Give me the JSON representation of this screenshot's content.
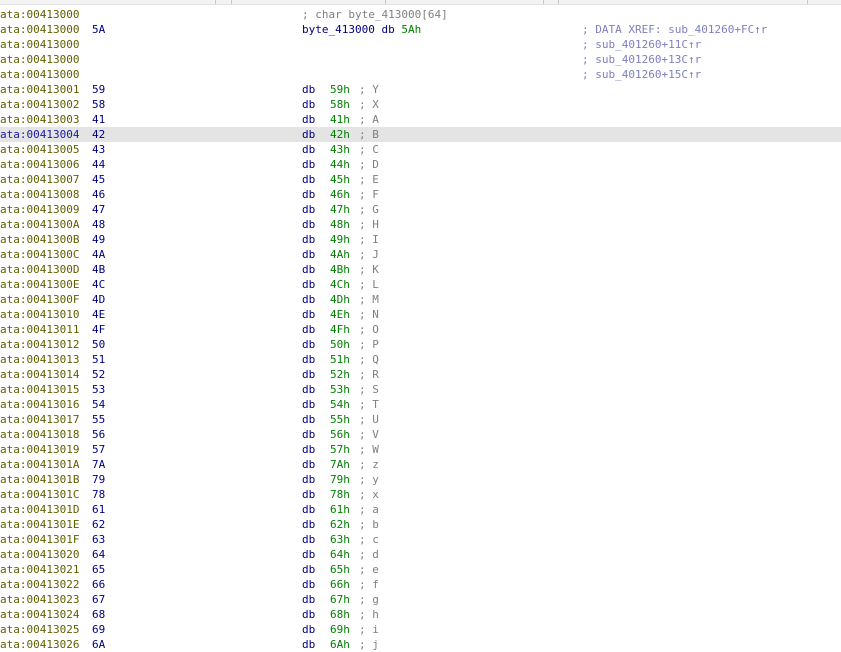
{
  "header": {
    "comment": "; char byte_413000[64]",
    "address": "ata:00413000"
  },
  "definition": {
    "address": "ata:00413000",
    "byte": "5A",
    "name": "byte_413000",
    "directive": "db",
    "value": "5Ah",
    "xref": "; DATA XREF: sub_401260+FC↑r"
  },
  "xref_lines": [
    {
      "address": "ata:00413000",
      "xref": "; sub_401260+11C↑r"
    },
    {
      "address": "ata:00413000",
      "xref": "; sub_401260+13C↑r"
    },
    {
      "address": "ata:00413000",
      "xref": "; sub_401260+15C↑r"
    }
  ],
  "rows": [
    {
      "address": "ata:00413001",
      "byte": "59",
      "op": "db",
      "value": "59h",
      "comment": "; Y"
    },
    {
      "address": "ata:00413002",
      "byte": "58",
      "op": "db",
      "value": "58h",
      "comment": "; X"
    },
    {
      "address": "ata:00413003",
      "byte": "41",
      "op": "db",
      "value": "41h",
      "comment": "; A"
    },
    {
      "address": "ata:00413004",
      "byte": "42",
      "op": "db",
      "value": "42h",
      "comment": "; B"
    },
    {
      "address": "ata:00413005",
      "byte": "43",
      "op": "db",
      "value": "43h",
      "comment": "; C"
    },
    {
      "address": "ata:00413006",
      "byte": "44",
      "op": "db",
      "value": "44h",
      "comment": "; D"
    },
    {
      "address": "ata:00413007",
      "byte": "45",
      "op": "db",
      "value": "45h",
      "comment": "; E"
    },
    {
      "address": "ata:00413008",
      "byte": "46",
      "op": "db",
      "value": "46h",
      "comment": "; F"
    },
    {
      "address": "ata:00413009",
      "byte": "47",
      "op": "db",
      "value": "47h",
      "comment": "; G"
    },
    {
      "address": "ata:0041300A",
      "byte": "48",
      "op": "db",
      "value": "48h",
      "comment": "; H"
    },
    {
      "address": "ata:0041300B",
      "byte": "49",
      "op": "db",
      "value": "49h",
      "comment": "; I"
    },
    {
      "address": "ata:0041300C",
      "byte": "4A",
      "op": "db",
      "value": "4Ah",
      "comment": "; J"
    },
    {
      "address": "ata:0041300D",
      "byte": "4B",
      "op": "db",
      "value": "4Bh",
      "comment": "; K"
    },
    {
      "address": "ata:0041300E",
      "byte": "4C",
      "op": "db",
      "value": "4Ch",
      "comment": "; L"
    },
    {
      "address": "ata:0041300F",
      "byte": "4D",
      "op": "db",
      "value": "4Dh",
      "comment": "; M"
    },
    {
      "address": "ata:00413010",
      "byte": "4E",
      "op": "db",
      "value": "4Eh",
      "comment": "; N"
    },
    {
      "address": "ata:00413011",
      "byte": "4F",
      "op": "db",
      "value": "4Fh",
      "comment": "; O"
    },
    {
      "address": "ata:00413012",
      "byte": "50",
      "op": "db",
      "value": "50h",
      "comment": "; P"
    },
    {
      "address": "ata:00413013",
      "byte": "51",
      "op": "db",
      "value": "51h",
      "comment": "; Q"
    },
    {
      "address": "ata:00413014",
      "byte": "52",
      "op": "db",
      "value": "52h",
      "comment": "; R"
    },
    {
      "address": "ata:00413015",
      "byte": "53",
      "op": "db",
      "value": "53h",
      "comment": "; S"
    },
    {
      "address": "ata:00413016",
      "byte": "54",
      "op": "db",
      "value": "54h",
      "comment": "; T"
    },
    {
      "address": "ata:00413017",
      "byte": "55",
      "op": "db",
      "value": "55h",
      "comment": "; U"
    },
    {
      "address": "ata:00413018",
      "byte": "56",
      "op": "db",
      "value": "56h",
      "comment": "; V"
    },
    {
      "address": "ata:00413019",
      "byte": "57",
      "op": "db",
      "value": "57h",
      "comment": "; W"
    },
    {
      "address": "ata:0041301A",
      "byte": "7A",
      "op": "db",
      "value": "7Ah",
      "comment": "; z"
    },
    {
      "address": "ata:0041301B",
      "byte": "79",
      "op": "db",
      "value": "79h",
      "comment": "; y"
    },
    {
      "address": "ata:0041301C",
      "byte": "78",
      "op": "db",
      "value": "78h",
      "comment": "; x"
    },
    {
      "address": "ata:0041301D",
      "byte": "61",
      "op": "db",
      "value": "61h",
      "comment": "; a"
    },
    {
      "address": "ata:0041301E",
      "byte": "62",
      "op": "db",
      "value": "62h",
      "comment": "; b"
    },
    {
      "address": "ata:0041301F",
      "byte": "63",
      "op": "db",
      "value": "63h",
      "comment": "; c"
    },
    {
      "address": "ata:00413020",
      "byte": "64",
      "op": "db",
      "value": "64h",
      "comment": "; d"
    },
    {
      "address": "ata:00413021",
      "byte": "65",
      "op": "db",
      "value": "65h",
      "comment": "; e"
    },
    {
      "address": "ata:00413022",
      "byte": "66",
      "op": "db",
      "value": "66h",
      "comment": "; f"
    },
    {
      "address": "ata:00413023",
      "byte": "67",
      "op": "db",
      "value": "67h",
      "comment": "; g"
    },
    {
      "address": "ata:00413024",
      "byte": "68",
      "op": "db",
      "value": "68h",
      "comment": "; h"
    },
    {
      "address": "ata:00413025",
      "byte": "69",
      "op": "db",
      "value": "69h",
      "comment": "; i"
    },
    {
      "address": "ata:00413026",
      "byte": "6A",
      "op": "db",
      "value": "6Ah",
      "comment": "; j"
    }
  ],
  "highlighted_row_index": 3,
  "colors": {
    "background": "#ffffff",
    "address": "#5f5f00",
    "highlight_row": "#e4e4e4",
    "instruction": "#00007f",
    "value": "#007f00",
    "comment": "#808080",
    "xref": "#7f7fbf"
  }
}
